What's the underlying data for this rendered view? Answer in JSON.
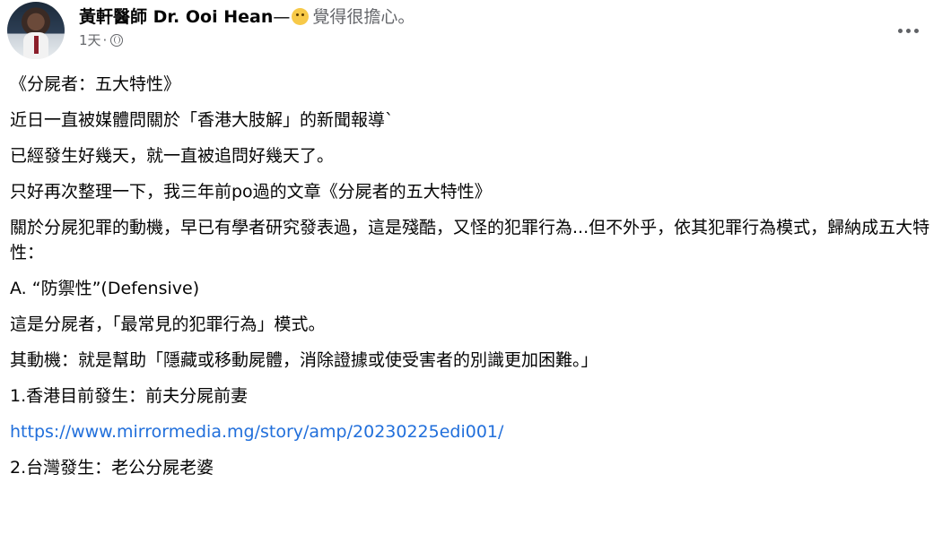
{
  "author": {
    "name": "黃軒醫師 Dr. Ooi Hean",
    "dash": "—",
    "feeling_text": "覺得很擔心。",
    "feeling_icon": "worried-face-emoji"
  },
  "post_time": "1天",
  "time_separator": "·",
  "privacy_icon": "globe-icon",
  "paragraphs": {
    "p0": "《分屍者：五大特性》",
    "p1": "近日一直被媒體問關於「香港大肢解」的新聞報導`",
    "p2": "已經發生好幾天，就一直被追問好幾天了。",
    "p3": "只好再次整理一下，我三年前po過的文章《分屍者的五大特性》",
    "p4": "關於分屍犯罪的動機，早已有學者研究發表過，這是殘酷，又怪的犯罪行為...但不外乎，依其犯罪行為模式，歸納成五大特性：",
    "p5": "A. “防禦性”(Defensive)",
    "p6": "這是分屍者，「最常見的犯罪行為」模式。",
    "p7": "其動機：就是幫助「隱藏或移動屍體，消除證據或使受害者的別識更加困難。」",
    "p8": "1.香港目前發生：前夫分屍前妻",
    "link": "https://www.mirrormedia.mg/story/amp/20230225edi001/",
    "p9": "2.台灣發生：老公分屍老婆"
  },
  "colors": {
    "link": "#216fdb",
    "secondary_text": "#65676b",
    "primary_text": "#050505"
  }
}
